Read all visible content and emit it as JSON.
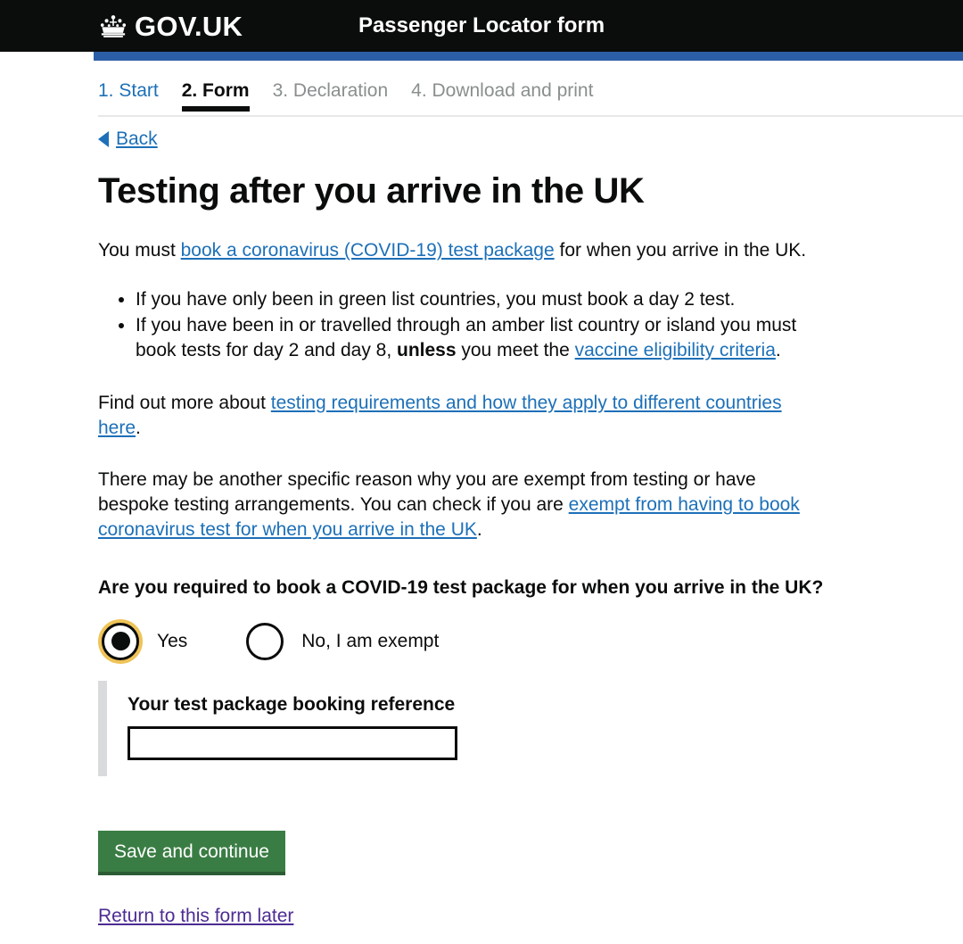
{
  "header": {
    "brand": "GOV.UK",
    "crown_icon": "crown-icon",
    "title": "Passenger Locator form"
  },
  "steps": [
    {
      "label": "1. Start",
      "state": "link"
    },
    {
      "label": "2. Form",
      "state": "active"
    },
    {
      "label": "3. Declaration",
      "state": "muted"
    },
    {
      "label": "4. Download and print",
      "state": "muted"
    }
  ],
  "back": {
    "icon": "back-arrow-icon",
    "label": "Back"
  },
  "main": {
    "heading": "Testing after you arrive in the UK",
    "intro": {
      "before": "You must ",
      "link": "book a coronavirus (COVID-19) test package",
      "after": " for when you arrive in the UK."
    },
    "bullets": {
      "item1": "If you have only been in green list countries, you must book a day 2 test.",
      "item2_part1": "If you have been in or travelled through an amber list country or island you must book tests for day 2 and day 8, ",
      "item2_bold": "unless",
      "item2_part2": " you meet the ",
      "item2_link": "vaccine eligibility criteria",
      "item2_part3": "."
    },
    "find_out_more": {
      "before": "Find out more about ",
      "link": "testing requirements and how they apply to different countries here",
      "after": "."
    },
    "exempt_paragraph": {
      "before": "There may be another specific reason why you are exempt from testing or have bespoke testing arrangements. You can check if you are ",
      "link": "exempt from having to book coronavirus test for when you arrive in the UK",
      "after": "."
    },
    "question": "Are you required to book a COVID-19 test package for when you arrive in the UK?",
    "radios": [
      {
        "label": "Yes",
        "selected": true,
        "focused": true
      },
      {
        "label": "No, I am exempt",
        "selected": false,
        "focused": false
      }
    ],
    "conditional": {
      "label": "Your test package booking reference",
      "input_value": "",
      "input_placeholder": ""
    },
    "save_button": "Save and continue",
    "return_link": "Return to this form later"
  },
  "colors": {
    "header_background": "#0b0c0c",
    "blue_band": "#2b5ea6",
    "link": "#1d70b8",
    "visited_link": "#4c2c92",
    "focus_ring": "#efc357",
    "button_green": "#3a7d44",
    "button_green_shadow": "#2c5c33",
    "muted_text": "#8a8e8f",
    "panel_border": "#d8dadb"
  }
}
